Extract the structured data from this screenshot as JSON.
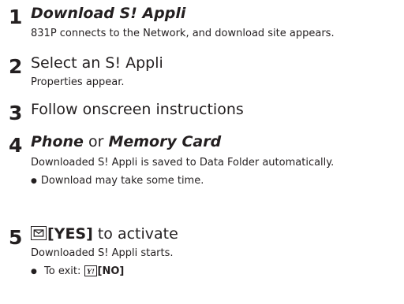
{
  "steps": [
    {
      "number": "1",
      "title": "Download S! Appli",
      "description": "831P connects to the Network, and download site appears."
    },
    {
      "number": "2",
      "title": "Select an S! Appli",
      "description": "Properties appear."
    },
    {
      "number": "3",
      "title": "Follow onscreen instructions"
    },
    {
      "number": "4",
      "title_part1": "Phone",
      "title_or": "or",
      "title_part2": "Memory Card",
      "description": "Downloaded S! Appli is saved to Data Folder automatically.",
      "note": "Download may take some time."
    },
    {
      "number": "5",
      "key_label": "[YES]",
      "title_rest": "to activate",
      "description": "Downloaded S! Appli starts.",
      "note_prefix": "To exit:",
      "note_key_label": "[NO]"
    }
  ],
  "icons": {
    "mail_key": "mail-key-icon",
    "yahoo_key": "yahoo-key-icon"
  }
}
